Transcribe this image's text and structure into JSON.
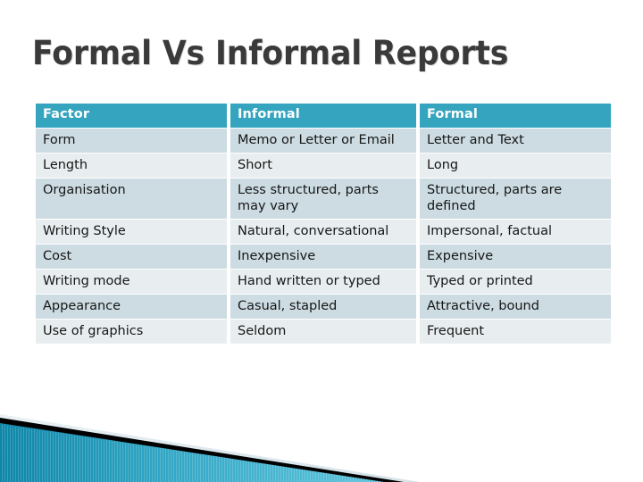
{
  "slide": {
    "title": "Formal Vs Informal Reports",
    "background_color": "#FFFFFF",
    "title_color": "#3A3A3A"
  },
  "table": {
    "header_background": "#35A5BF",
    "header_text_color": "#FFFFFF",
    "row_band_dark": "#CCDCE2",
    "row_band_light": "#E8EEF0",
    "body_text_color": "#161616",
    "columns": [
      "Factor",
      "Informal",
      "Formal"
    ],
    "rows": [
      {
        "factor": "Form",
        "informal": "Memo or Letter or Email",
        "formal": "Letter and Text"
      },
      {
        "factor": "Length",
        "informal": "Short",
        "formal": "Long"
      },
      {
        "factor": "Organisation",
        "informal": "Less structured, parts may vary",
        "formal": "Structured, parts are defined"
      },
      {
        "factor": "Writing Style",
        "informal": "Natural, conversational",
        "formal": "Impersonal, factual"
      },
      {
        "factor": "Cost",
        "informal": "Inexpensive",
        "formal": "Expensive"
      },
      {
        "factor": "Writing mode",
        "informal": "Hand written or typed",
        "formal": "Typed or printed"
      },
      {
        "factor": "Appearance",
        "informal": "Casual, stapled",
        "formal": "Attractive, bound"
      },
      {
        "factor": "Use of graphics",
        "informal": "Seldom",
        "formal": "Frequent"
      }
    ]
  },
  "decoration": {
    "name": "bottom-left-diagonal-banner",
    "teal_dark": "#0E86A8",
    "teal_light": "#5FC4DC",
    "accent_black": "#000000",
    "pale_band": "#DDE8EC"
  }
}
